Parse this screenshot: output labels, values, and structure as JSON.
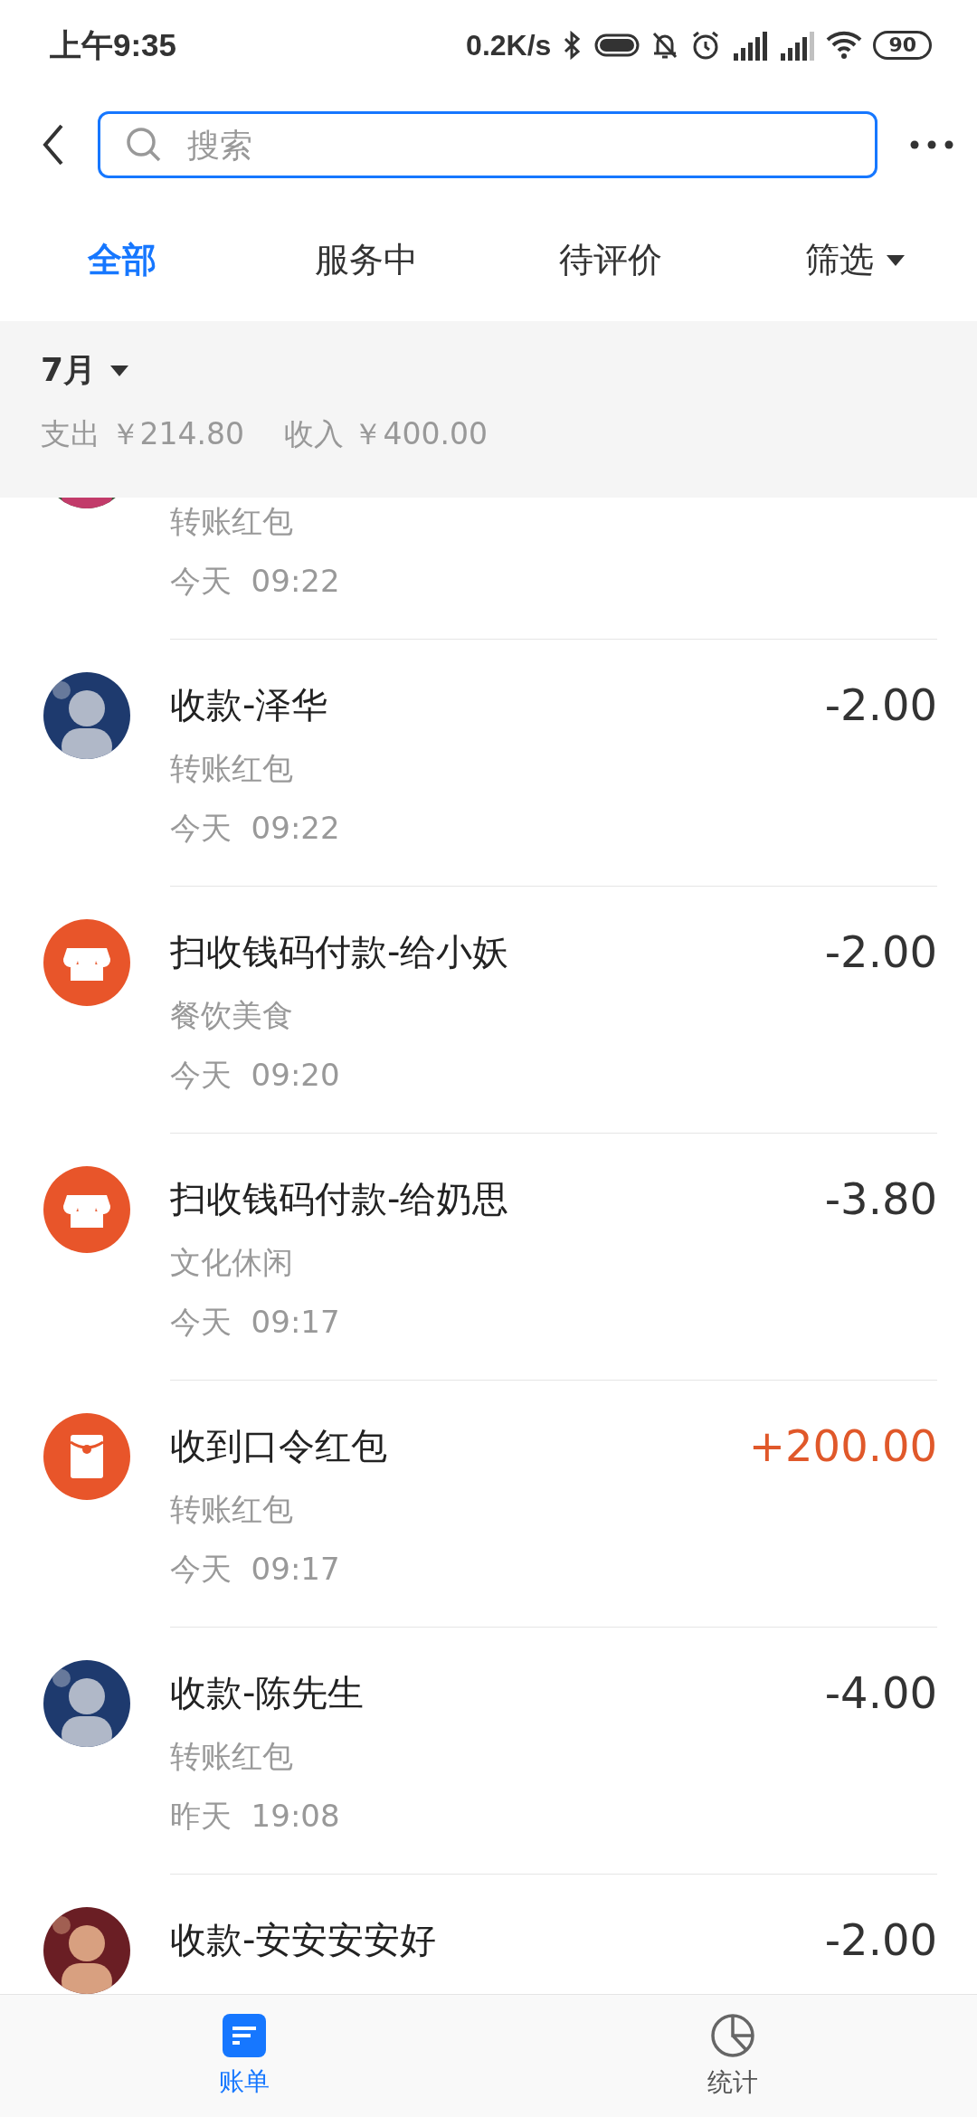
{
  "status_bar": {
    "time": "上午9:35",
    "speed": "0.2K/s",
    "battery": "90"
  },
  "search": {
    "placeholder": "搜索"
  },
  "tabs": [
    {
      "label": "全部",
      "selected": true
    },
    {
      "label": "服务中",
      "selected": false
    },
    {
      "label": "待评价",
      "selected": false
    },
    {
      "label": "筛选",
      "selected": false,
      "kind": "dropdown"
    }
  ],
  "month": {
    "label": "7月",
    "expense_label": "支出",
    "expense": "￥214.80",
    "income_label": "收入",
    "income": "￥400.00"
  },
  "transactions": [
    {
      "subtitle": "转账红包",
      "time": "今天  09:22"
    },
    {
      "title": "收款-泽华",
      "amount": "-2.00",
      "income": false,
      "subtitle": "转账红包",
      "time": "今天  09:22"
    },
    {
      "kind": "shop",
      "title": "扫收钱码付款-给小妖",
      "amount": "-2.00",
      "income": false,
      "subtitle": "餐饮美食",
      "time": "今天  09:20"
    },
    {
      "kind": "shop",
      "title": "扫收钱码付款-给奶思",
      "amount": "-3.80",
      "income": false,
      "subtitle": "文化休闲",
      "time": "今天  09:17"
    },
    {
      "kind": "envelope",
      "title": "收到口令红包",
      "amount": "+200.00",
      "income": true,
      "subtitle": "转账红包",
      "time": "今天  09:17"
    },
    {
      "title": "收款-陈先生",
      "amount": "-4.00",
      "income": false,
      "subtitle": "转账红包",
      "time": "昨天  19:08"
    },
    {
      "title": "收款-安安安安好",
      "amount": "-2.00",
      "income": false
    }
  ],
  "bottom_nav": [
    {
      "label": "账单",
      "selected": true,
      "kind": "bill"
    },
    {
      "label": "统计",
      "selected": false,
      "kind": "stats"
    }
  ]
}
